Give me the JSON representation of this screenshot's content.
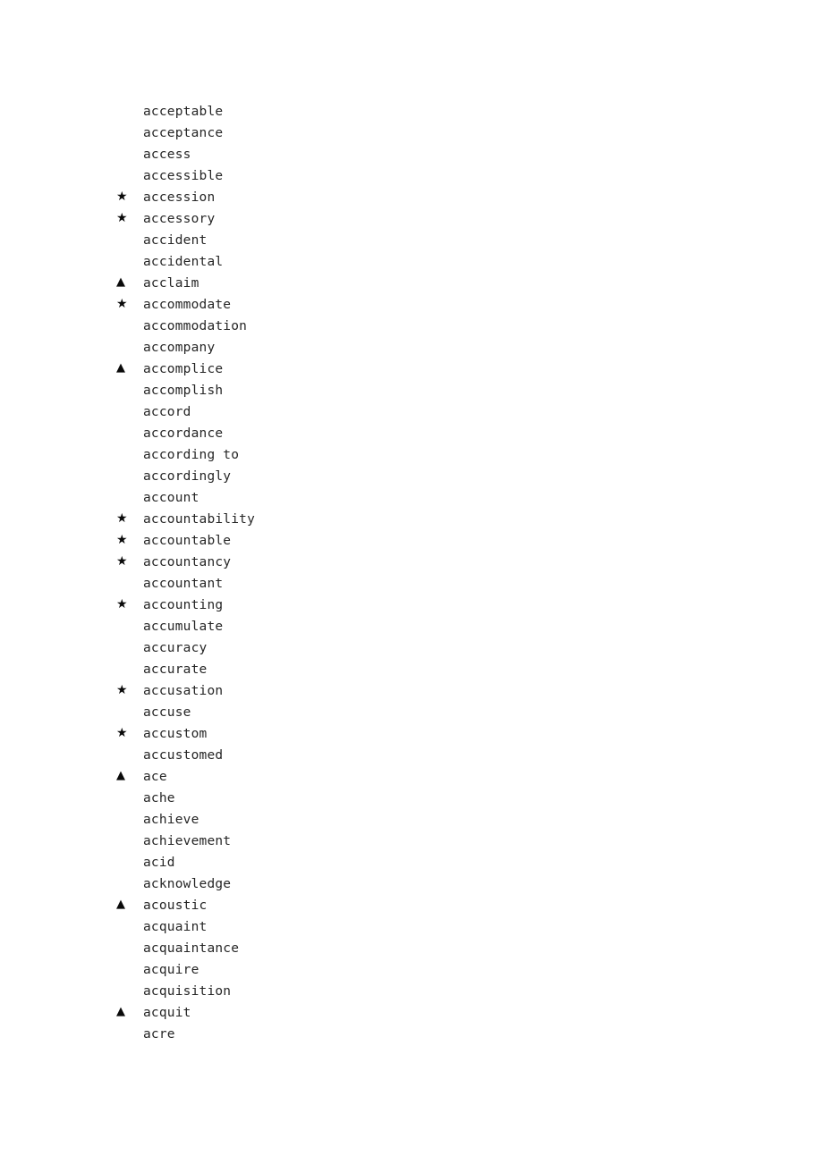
{
  "document": {
    "type": "vocabulary-word-list",
    "markers": {
      "star": "★",
      "triangle": "▲",
      "none": ""
    },
    "marker_names": {
      "star": "star-marker-icon",
      "triangle": "triangle-marker-icon",
      "none": "no-marker"
    },
    "colors": {
      "text": "#262626",
      "marker": "#0a0a0a",
      "background": "#ffffff"
    },
    "entries": [
      {
        "marker": "none",
        "word": "acceptable"
      },
      {
        "marker": "none",
        "word": "acceptance"
      },
      {
        "marker": "none",
        "word": "access"
      },
      {
        "marker": "none",
        "word": "accessible"
      },
      {
        "marker": "star",
        "word": "accession"
      },
      {
        "marker": "star",
        "word": "accessory"
      },
      {
        "marker": "none",
        "word": "accident"
      },
      {
        "marker": "none",
        "word": "accidental"
      },
      {
        "marker": "triangle",
        "word": "acclaim"
      },
      {
        "marker": "star",
        "word": "accommodate"
      },
      {
        "marker": "none",
        "word": "accommodation"
      },
      {
        "marker": "none",
        "word": "accompany"
      },
      {
        "marker": "triangle",
        "word": "accomplice"
      },
      {
        "marker": "none",
        "word": "accomplish"
      },
      {
        "marker": "none",
        "word": "accord"
      },
      {
        "marker": "none",
        "word": "accordance"
      },
      {
        "marker": "none",
        "word": "according to"
      },
      {
        "marker": "none",
        "word": "accordingly"
      },
      {
        "marker": "none",
        "word": "account"
      },
      {
        "marker": "star",
        "word": "accountability"
      },
      {
        "marker": "star",
        "word": "accountable"
      },
      {
        "marker": "star",
        "word": "accountancy"
      },
      {
        "marker": "none",
        "word": "accountant"
      },
      {
        "marker": "star",
        "word": "accounting"
      },
      {
        "marker": "none",
        "word": "accumulate"
      },
      {
        "marker": "none",
        "word": "accuracy"
      },
      {
        "marker": "none",
        "word": "accurate"
      },
      {
        "marker": "star",
        "word": "accusation"
      },
      {
        "marker": "none",
        "word": "accuse"
      },
      {
        "marker": "star",
        "word": "accustom"
      },
      {
        "marker": "none",
        "word": "accustomed"
      },
      {
        "marker": "triangle",
        "word": "ace"
      },
      {
        "marker": "none",
        "word": "ache"
      },
      {
        "marker": "none",
        "word": "achieve"
      },
      {
        "marker": "none",
        "word": "achievement"
      },
      {
        "marker": "none",
        "word": "acid"
      },
      {
        "marker": "none",
        "word": "acknowledge"
      },
      {
        "marker": "triangle",
        "word": "acoustic"
      },
      {
        "marker": "none",
        "word": "acquaint"
      },
      {
        "marker": "none",
        "word": "acquaintance"
      },
      {
        "marker": "none",
        "word": "acquire"
      },
      {
        "marker": "none",
        "word": "acquisition"
      },
      {
        "marker": "triangle",
        "word": "acquit"
      },
      {
        "marker": "none",
        "word": "acre"
      }
    ]
  }
}
